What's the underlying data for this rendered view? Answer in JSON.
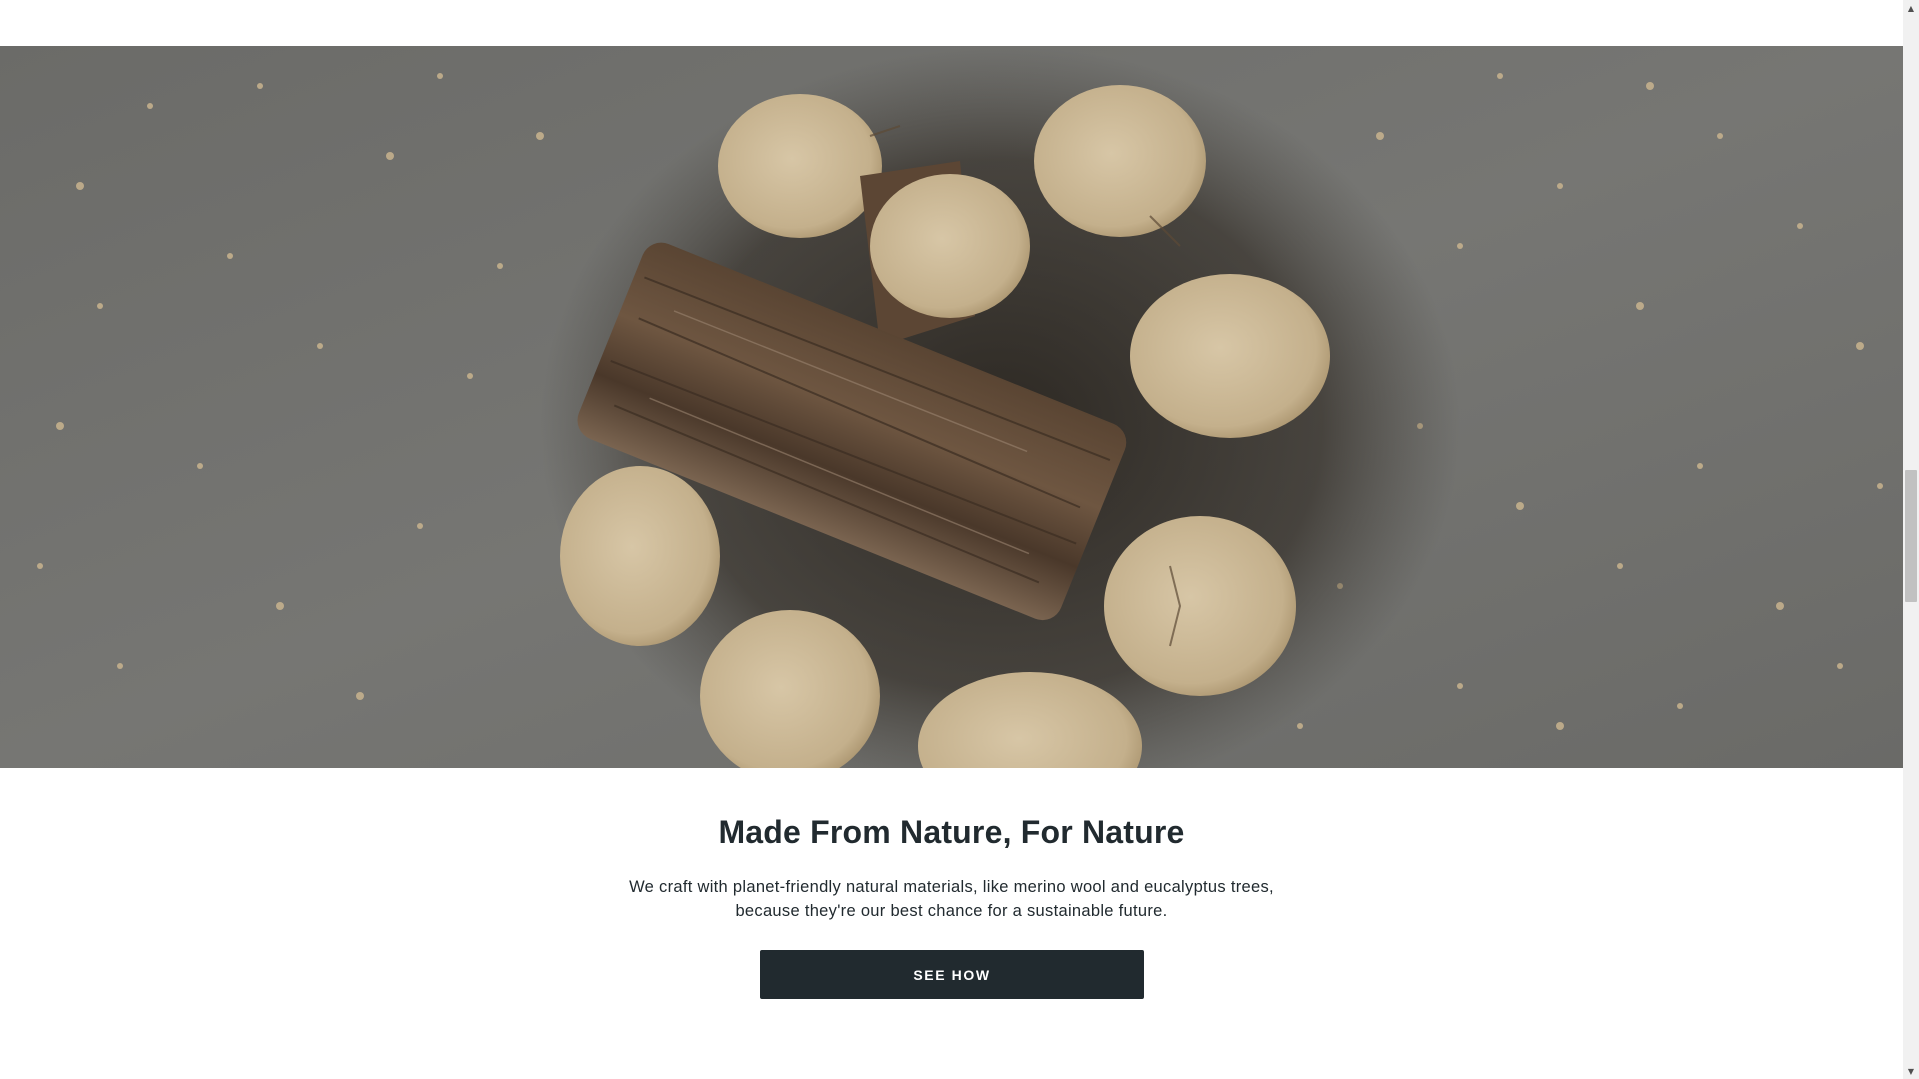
{
  "hero": {
    "image_alt": "logs-image"
  },
  "section": {
    "heading": "Made From Nature, For Nature",
    "body_line1": "We craft with planet-friendly natural materials, like merino wool and eucalyptus trees,",
    "body_line2": "because they're our best chance for a sustainable future.",
    "cta_label": "SEE HOW"
  },
  "colors": {
    "text": "#212a2f",
    "button_bg": "#212a2f",
    "button_text": "#ffffff",
    "hero_bg": "#6f6f6c"
  },
  "scrollbar": {
    "up_icon": "scroll-up-arrow-icon",
    "down_icon": "scroll-down-arrow-icon"
  }
}
